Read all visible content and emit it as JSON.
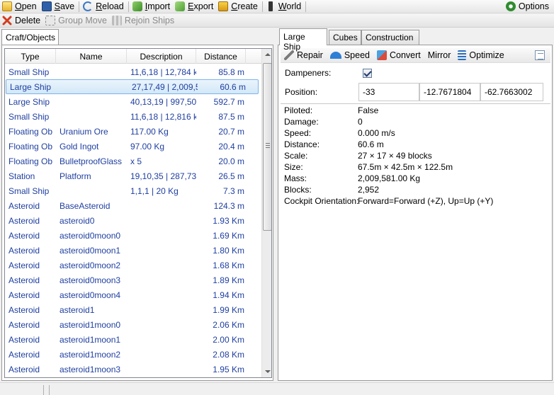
{
  "toolbar": {
    "open": "Open",
    "save": "Save",
    "reload": "Reload",
    "import": "Import",
    "export": "Export",
    "create": "Create",
    "world": "World",
    "options": "Options"
  },
  "toolbar2": {
    "delete": "Delete",
    "group_move": "Group Move",
    "rejoin_ships": "Rejoin Ships"
  },
  "left": {
    "tab_label": "Craft/Objects",
    "columns": {
      "type": "Type",
      "name": "Name",
      "description": "Description",
      "distance": "Distance"
    },
    "rows": [
      {
        "type": "Small Ship",
        "name": "",
        "description": "11,6,18 | 12,784 k",
        "distance": "85.8 m"
      },
      {
        "type": "Large Ship",
        "name": "",
        "description": "27,17,49 | 2,009,5",
        "distance": "60.6 m"
      },
      {
        "type": "Large Ship",
        "name": "",
        "description": "40,13,19 | 997,50",
        "distance": "592.7 m"
      },
      {
        "type": "Small Ship",
        "name": "",
        "description": "11,6,18 | 12,816 k",
        "distance": "87.5 m"
      },
      {
        "type": "Floating Ob",
        "name": "Uranium Ore",
        "description": "117.00 Kg",
        "distance": "20.7 m"
      },
      {
        "type": "Floating Ob",
        "name": "Gold Ingot",
        "description": "97.00 Kg",
        "distance": "20.4 m"
      },
      {
        "type": "Floating Ob",
        "name": "BulletproofGlass",
        "description": "x 5",
        "distance": "20.0 m"
      },
      {
        "type": "Station",
        "name": "Platform",
        "description": "19,10,35 | 287,73",
        "distance": "26.5 m"
      },
      {
        "type": "Small Ship",
        "name": "",
        "description": "1,1,1 | 20 Kg",
        "distance": "7.3 m"
      },
      {
        "type": "Asteroid",
        "name": "BaseAsteroid",
        "description": "",
        "distance": "124.3 m"
      },
      {
        "type": "Asteroid",
        "name": "asteroid0",
        "description": "",
        "distance": "1.93 Km"
      },
      {
        "type": "Asteroid",
        "name": "asteroid0moon0",
        "description": "",
        "distance": "1.69 Km"
      },
      {
        "type": "Asteroid",
        "name": "asteroid0moon1",
        "description": "",
        "distance": "1.80 Km"
      },
      {
        "type": "Asteroid",
        "name": "asteroid0moon2",
        "description": "",
        "distance": "1.68 Km"
      },
      {
        "type": "Asteroid",
        "name": "asteroid0moon3",
        "description": "",
        "distance": "1.89 Km"
      },
      {
        "type": "Asteroid",
        "name": "asteroid0moon4",
        "description": "",
        "distance": "1.94 Km"
      },
      {
        "type": "Asteroid",
        "name": "asteroid1",
        "description": "",
        "distance": "1.99 Km"
      },
      {
        "type": "Asteroid",
        "name": "asteroid1moon0",
        "description": "",
        "distance": "2.06 Km"
      },
      {
        "type": "Asteroid",
        "name": "asteroid1moon1",
        "description": "",
        "distance": "2.00 Km"
      },
      {
        "type": "Asteroid",
        "name": "asteroid1moon2",
        "description": "",
        "distance": "2.08 Km"
      },
      {
        "type": "Asteroid",
        "name": "asteroid1moon3",
        "description": "",
        "distance": "1.95 Km"
      }
    ],
    "selected_index": 1
  },
  "right": {
    "tabs": [
      "Large Ship",
      "Cubes",
      "Construction"
    ],
    "active_tab": 0,
    "toolbar": {
      "repair": "Repair",
      "speed": "Speed",
      "convert": "Convert",
      "mirror": "Mirror",
      "optimize": "Optimize"
    },
    "dampeners_label": "Dampeners:",
    "dampeners_checked": true,
    "position_label": "Position:",
    "position": {
      "x": "-33",
      "y": "-12.7671804",
      "z": "-62.7663002"
    },
    "details": [
      {
        "label": "Piloted:",
        "value": "False"
      },
      {
        "label": "Damage:",
        "value": "0"
      },
      {
        "label": "Speed:",
        "value": "0.000 m/s"
      },
      {
        "label": "Distance:",
        "value": "60.6 m"
      },
      {
        "label": "Scale:",
        "value": "27 × 17 × 49 blocks"
      },
      {
        "label": "Size:",
        "value": "67.5m × 42.5m × 122.5m"
      },
      {
        "label": "Mass:",
        "value": "2,009,581.00 Kg"
      },
      {
        "label": "Blocks:",
        "value": "2,952"
      },
      {
        "label": "Cockpit Orientation:",
        "value": "Forward=Forward (+Z), Up=Up (+Y)"
      }
    ]
  },
  "colors": {
    "link_text": "#1f3fa0",
    "selection_border": "#7eb4ea",
    "selection_fill": "#d3e8f8"
  }
}
